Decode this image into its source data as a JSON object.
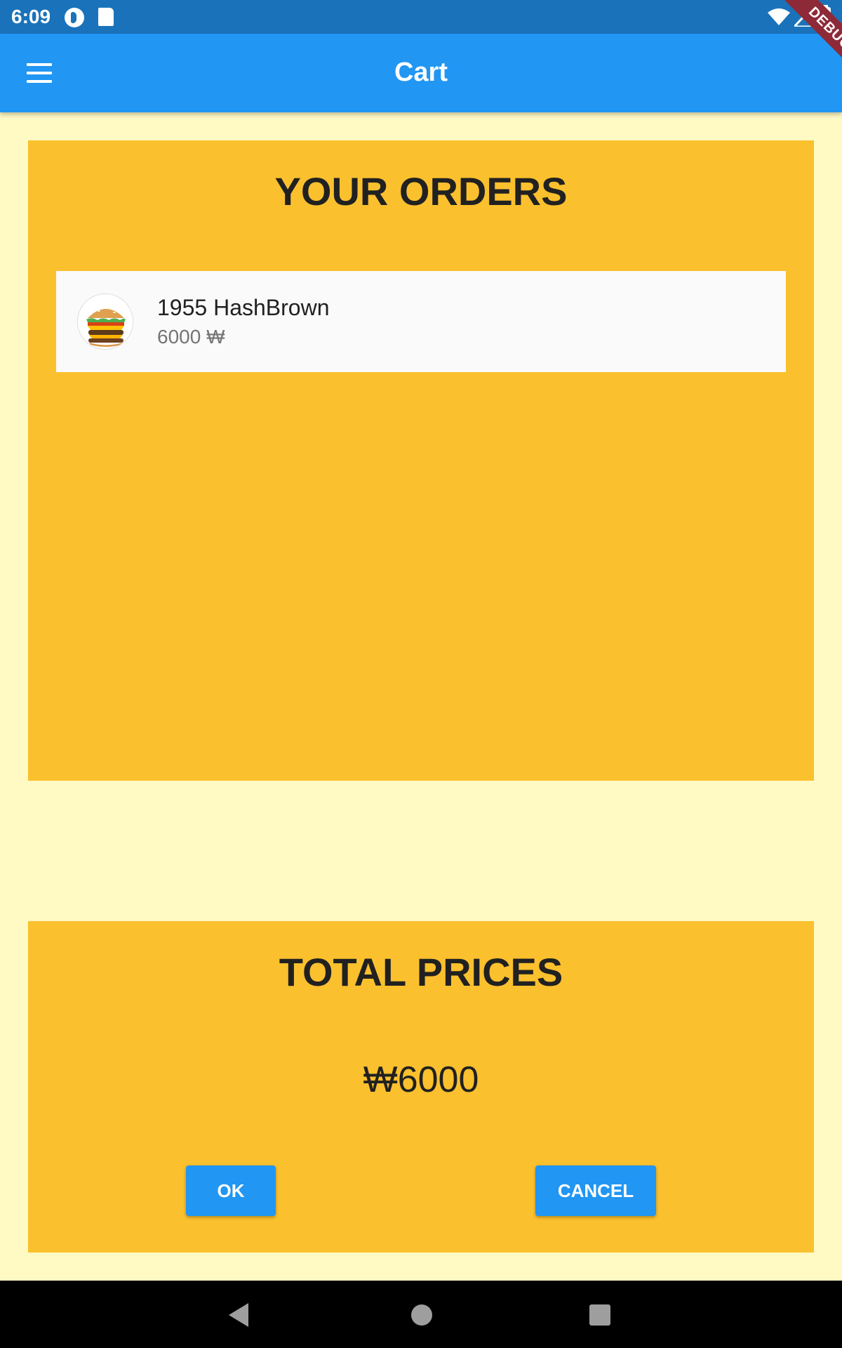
{
  "status_bar": {
    "time": "6:09",
    "icons": [
      "app-notification-icon",
      "sd-card-icon",
      "wifi-icon",
      "cell-signal-icon",
      "battery-icon"
    ]
  },
  "app_bar": {
    "title": "Cart",
    "menu_icon": "menu-icon",
    "background": "#2196F3"
  },
  "debug_banner": {
    "label": "DEBUG"
  },
  "orders": {
    "title": "YOUR ORDERS",
    "items": [
      {
        "name": "1955 HashBrown",
        "price": "6000 ₩",
        "image": "burger-image"
      }
    ],
    "background": "#FBC02D"
  },
  "totals": {
    "title": "TOTAL PRICES",
    "value": "₩6000",
    "ok_label": "OK",
    "cancel_label": "CANCEL"
  },
  "nav_bar": {
    "icons": [
      "back-icon",
      "home-icon",
      "recents-icon"
    ]
  },
  "colors": {
    "page_background": "#FFF9C4",
    "panel": "#FBC02D",
    "accent": "#2196F3",
    "status_bar": "#1A73BA"
  }
}
